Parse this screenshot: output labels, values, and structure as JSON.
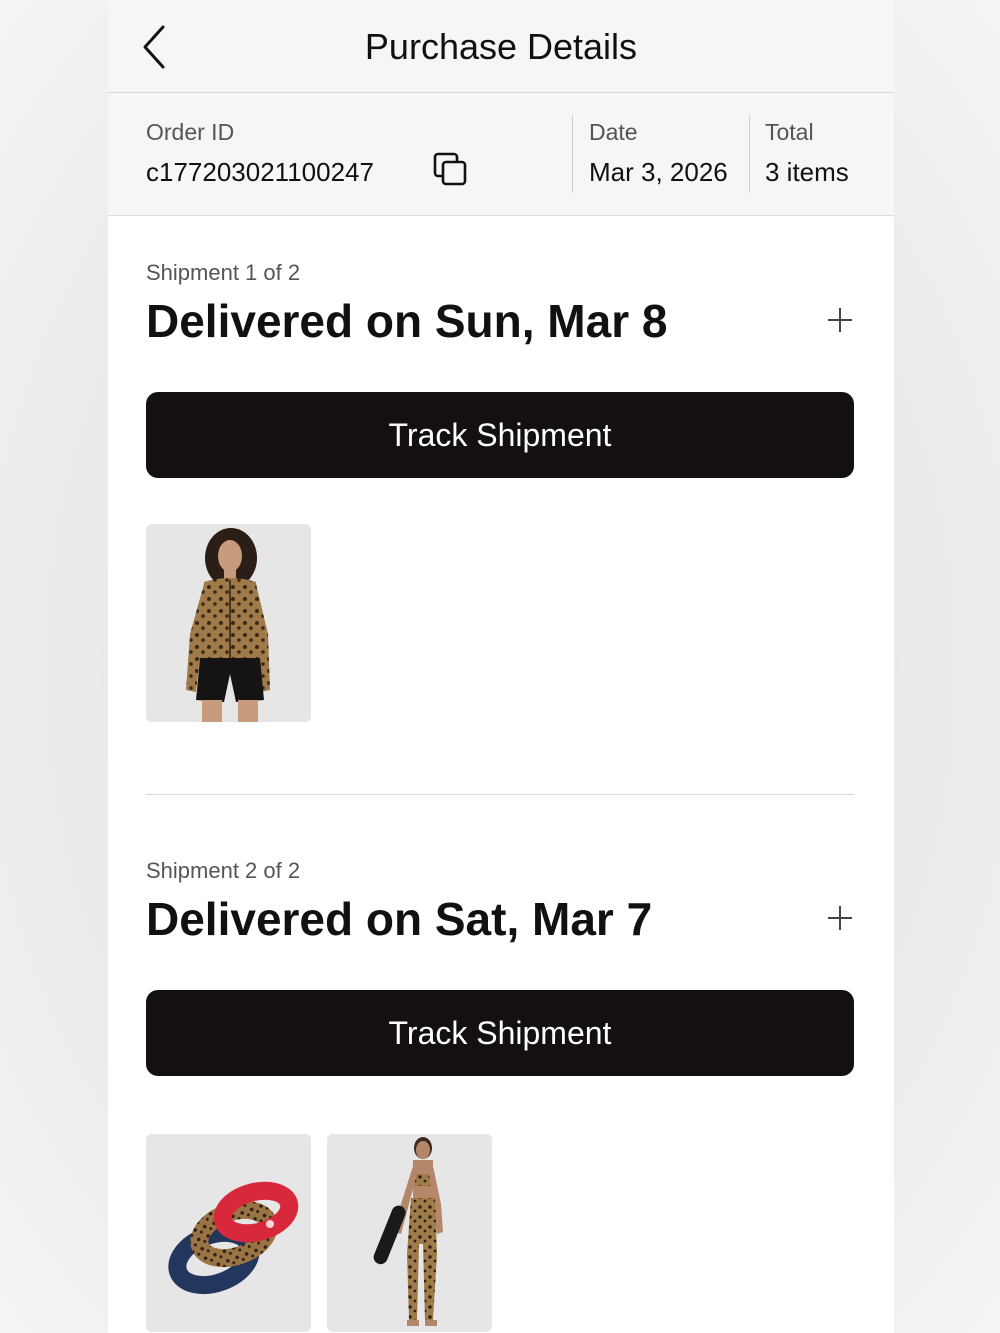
{
  "header": {
    "title": "Purchase Details"
  },
  "order": {
    "id_label": "Order ID",
    "id_value": "c177203021100247",
    "date_label": "Date",
    "date_value": "Mar 3, 2026",
    "total_label": "Total",
    "total_value": "3 items"
  },
  "shipments": [
    {
      "count": "Shipment 1 of 2",
      "status": "Delivered on Sun, Mar 8",
      "track_label": "Track Shipment",
      "items": [
        "leopard-print-zip-jacket"
      ]
    },
    {
      "count": "Shipment 2 of 2",
      "status": "Delivered on Sat, Mar 7",
      "track_label": "Track Shipment",
      "items": [
        "scrunchie-set",
        "leopard-print-bra-and-leggings"
      ]
    }
  ],
  "icons": {
    "back": "chevron-left-icon",
    "copy": "copy-icon",
    "expand": "plus-icon"
  },
  "colors": {
    "button_bg": "#140f10",
    "button_text": "#ffffff",
    "header_bg": "#f6f6f6"
  }
}
